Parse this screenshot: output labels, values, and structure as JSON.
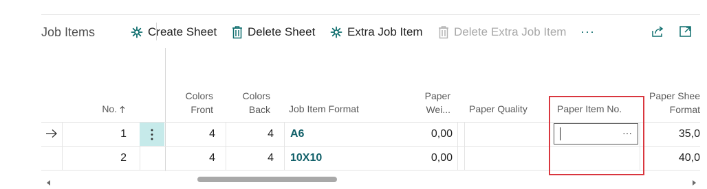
{
  "toolbar": {
    "title": "Job Items",
    "create_sheet": "Create Sheet",
    "delete_sheet": "Delete Sheet",
    "extra_job_item": "Extra Job Item",
    "delete_extra_job_item": "Delete Extra Job Item",
    "more": "···"
  },
  "columns": {
    "no": "No.",
    "colors_front": [
      "Colors",
      "Front"
    ],
    "colors_back": [
      "Colors",
      "Back"
    ],
    "job_item_format": "Job Item Format",
    "paper_weight": [
      "Paper",
      "Wei..."
    ],
    "paper_quality": "Paper Quality",
    "paper_item_no": "Paper Item No.",
    "paper_sheet_format": [
      "Paper Shee",
      "Format"
    ]
  },
  "rows": [
    {
      "no": "1",
      "colors_front": "4",
      "colors_back": "4",
      "job_item_format": "A6",
      "paper_weight": "0,00",
      "paper_quality": "",
      "paper_item_no": "",
      "paper_sheet_format": "35,0"
    },
    {
      "no": "2",
      "colors_front": "4",
      "colors_back": "4",
      "job_item_format": "10X10",
      "paper_weight": "0,00",
      "paper_quality": "",
      "paper_item_no": "",
      "paper_sheet_format": "40,0"
    }
  ],
  "cell_more": "···",
  "colors": {
    "accent": "#0f6e6e",
    "highlight_box": "#d9363e",
    "selected_cell": "#c6eaea"
  }
}
